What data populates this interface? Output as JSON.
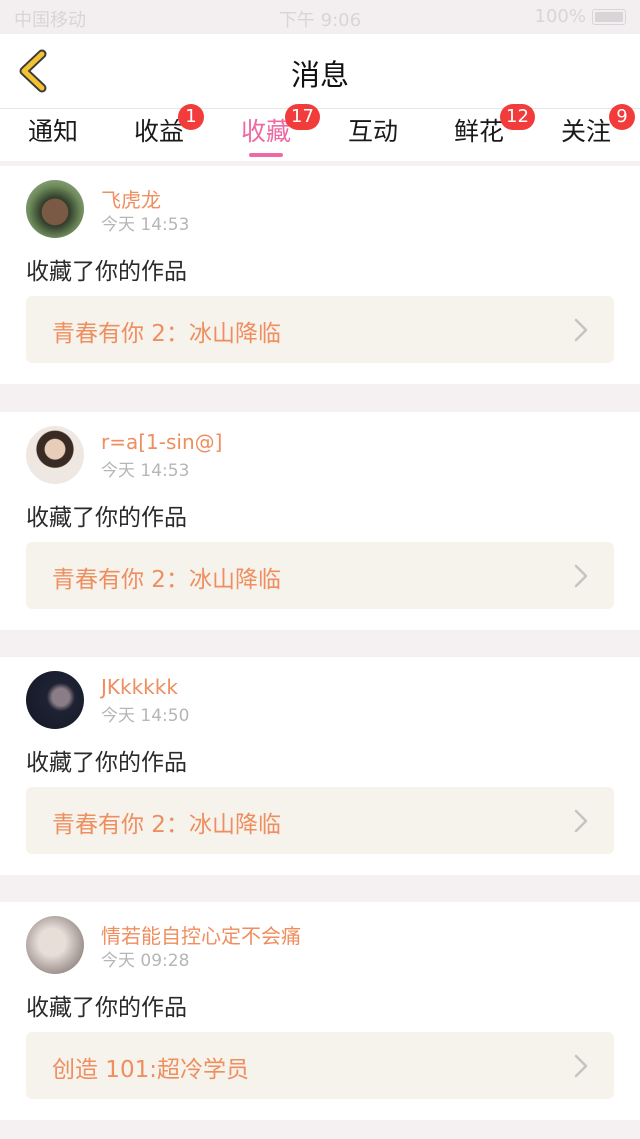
{
  "status_bar": {
    "carrier": "中国移动",
    "time": "下午 9:06",
    "battery": "100%"
  },
  "header": {
    "title": "消息",
    "back_icon": "chevron-left-icon"
  },
  "tabs": [
    {
      "label": "通知",
      "badge": ""
    },
    {
      "label": "收益",
      "badge": "1"
    },
    {
      "label": "收藏",
      "badge": "17",
      "active": true
    },
    {
      "label": "互动",
      "badge": ""
    },
    {
      "label": "鲜花",
      "badge": "12"
    },
    {
      "label": "关注",
      "badge": "9"
    }
  ],
  "colors": {
    "accent_pink": "#ee6aa4",
    "name_orange": "#ef8e5f",
    "badge_red": "#f23c3c",
    "back_yellow": "#f2c230"
  },
  "messages": [
    {
      "username": "飞虎龙",
      "time": "今天 14:53",
      "action": "收藏了你的作品",
      "work_title": "青春有你 2：冰山降临"
    },
    {
      "username": "r=a[1-sin@]",
      "time": "今天 14:53",
      "action": "收藏了你的作品",
      "work_title": "青春有你 2：冰山降临"
    },
    {
      "username": "JKkkkkk",
      "time": "今天 14:50",
      "action": "收藏了你的作品",
      "work_title": "青春有你 2：冰山降临"
    },
    {
      "username": "情若能自控心定不会痛",
      "time": "今天 09:28",
      "action": "收藏了你的作品",
      "work_title": "创造 101:超冷学员"
    }
  ]
}
